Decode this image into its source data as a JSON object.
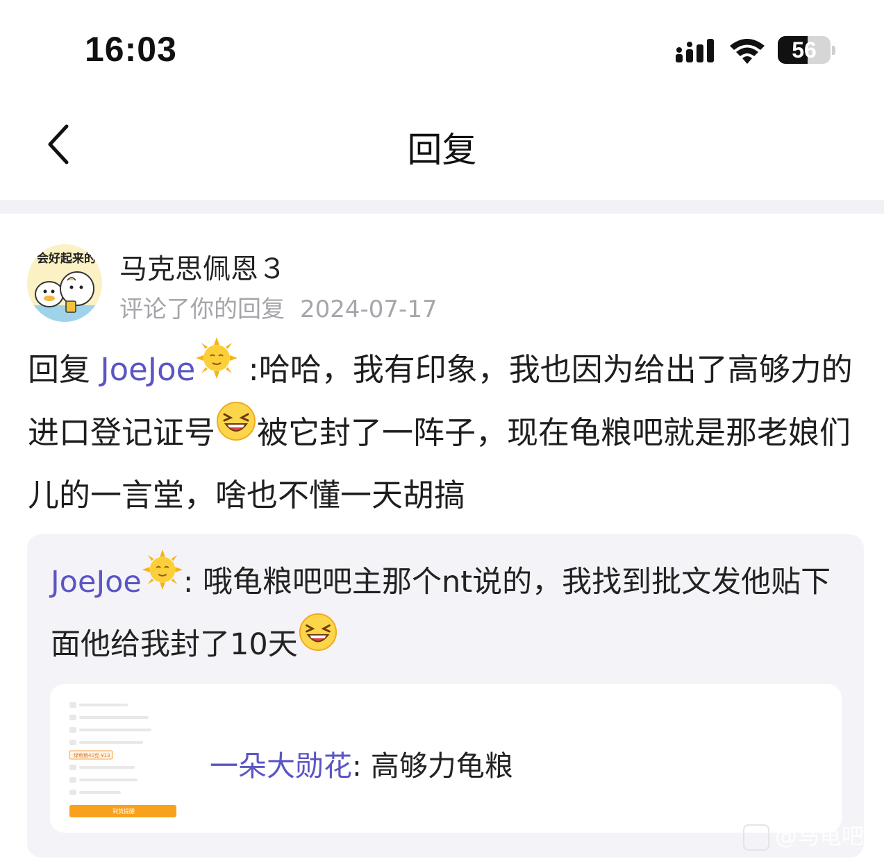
{
  "status_bar": {
    "time": "16:03",
    "battery_level": 56,
    "battery_text": "56"
  },
  "nav": {
    "title": "回复",
    "back_icon": "chevron-left-icon"
  },
  "post": {
    "avatar_caption": "会好起来的",
    "author": "马克思佩恩３",
    "action": "评论了你的回复",
    "date": "2024-07-17",
    "text": {
      "prefix": "回复 ",
      "mention": "JoeJoe",
      "mention_emoji": "sun-face-icon",
      "part1": " :哈哈，我有印象，我也因为给出了高够力的进口登记证号",
      "laugh_emoji": "laughing-face-icon",
      "part2": "被它封了一阵子，现在龟粮吧就是那老娘们儿的一言堂，啥也不懂一天胡搞"
    }
  },
  "quote": {
    "author": "JoeJoe",
    "author_emoji": "sun-face-icon",
    "separator": ": ",
    "text": "哦龟粮吧吧主那个nt说的，我找到批文发他贴下面他给我封了10天",
    "laugh_emoji": "laughing-face-icon",
    "card": {
      "author": "一朵大勋花",
      "separator": ": ",
      "title": "高够力龟粮",
      "thumb_button": "到货提醒",
      "thumb_tag": "绿龟粮40克 ¥13"
    }
  },
  "watermark": "@马龟吧"
}
